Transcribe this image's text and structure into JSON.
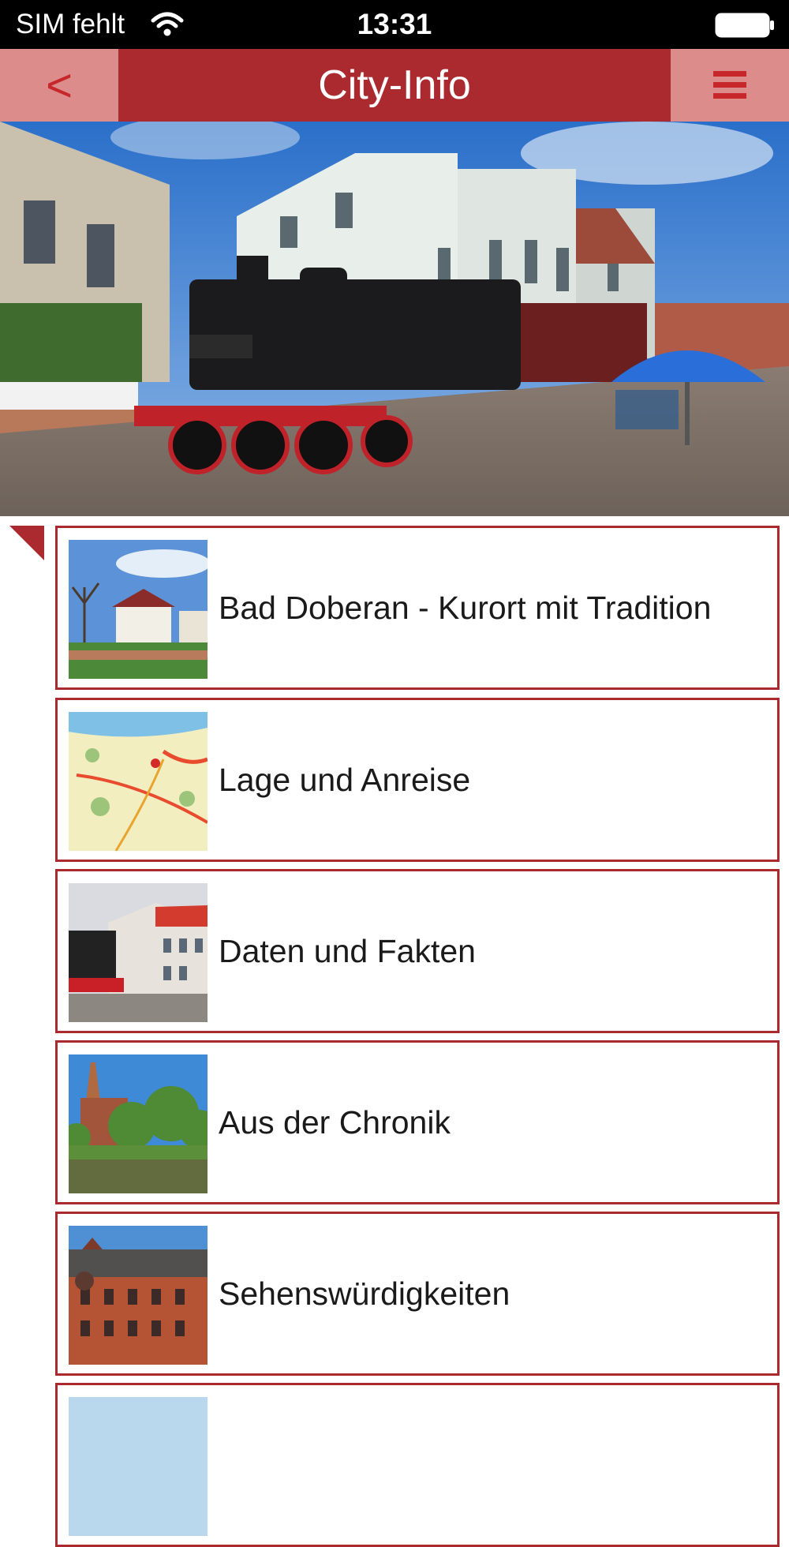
{
  "status_bar": {
    "carrier": "SIM fehlt",
    "time": "13:31"
  },
  "nav": {
    "back_label": "<",
    "title": "City-Info"
  },
  "list": {
    "items": [
      {
        "label": "Bad Doberan - Kurort mit Tradition"
      },
      {
        "label": "Lage und Anreise"
      },
      {
        "label": "Daten und Fakten"
      },
      {
        "label": "Aus der Chronik"
      },
      {
        "label": "Sehenswürdigkeiten"
      },
      {
        "label": ""
      }
    ]
  },
  "colors": {
    "accent": "#aa2a2f",
    "accent_light": "#dd8c8c",
    "icon_red": "#c7272b"
  }
}
